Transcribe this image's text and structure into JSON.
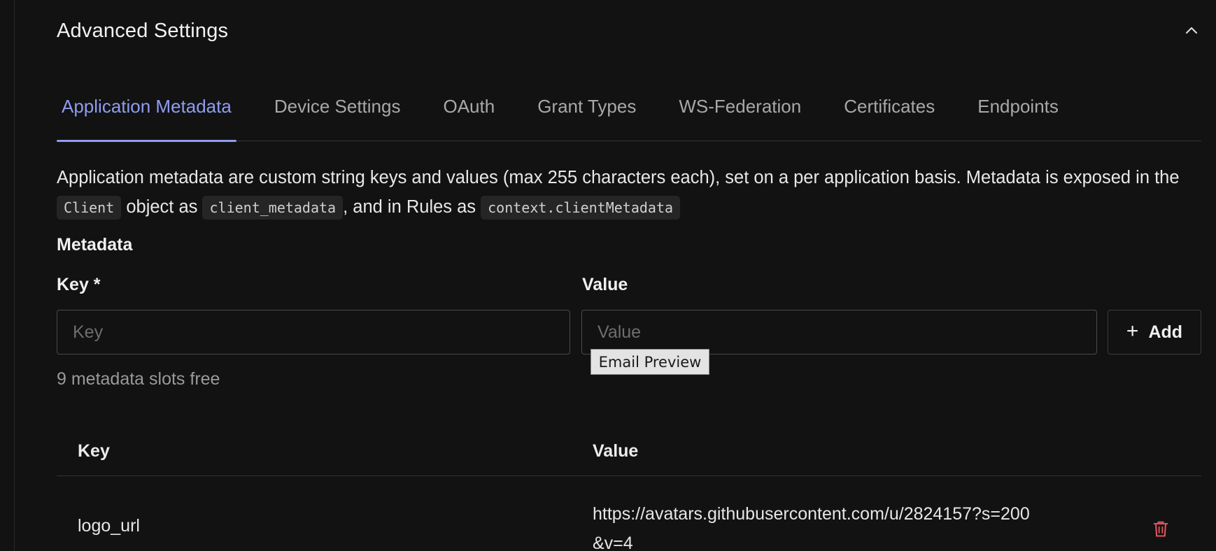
{
  "section": {
    "title": "Advanced Settings"
  },
  "tabs": [
    {
      "label": "Application Metadata",
      "active": true
    },
    {
      "label": "Device Settings",
      "active": false
    },
    {
      "label": "OAuth",
      "active": false
    },
    {
      "label": "Grant Types",
      "active": false
    },
    {
      "label": "WS-Federation",
      "active": false
    },
    {
      "label": "Certificates",
      "active": false
    },
    {
      "label": "Endpoints",
      "active": false
    }
  ],
  "description": {
    "text_1": "Application metadata are custom string keys and values (max 255 characters each), set on a per application basis. Metadata is exposed in the ",
    "code_1": "Client",
    "text_2": " object as ",
    "code_2": "client_metadata",
    "text_3": ", and in Rules as ",
    "code_3": "context.clientMetadata"
  },
  "metadata_form": {
    "heading": "Metadata",
    "key_label": "Key *",
    "value_label": "Value",
    "key_placeholder": "Key",
    "value_placeholder": "Value",
    "key_value": "",
    "value_value": "",
    "add_label": "Add",
    "slots_free": "9 metadata slots free"
  },
  "tooltip": {
    "text": "Email Preview"
  },
  "table": {
    "headers": {
      "key": "Key",
      "value": "Value"
    },
    "rows": [
      {
        "key": "logo_url",
        "value": "https://avatars.githubusercontent.com/u/2824157?s=200&v=4"
      }
    ]
  },
  "icons": {
    "collapse": "chevron-up-icon",
    "add": "plus-icon",
    "delete": "trash-icon"
  },
  "colors": {
    "background": "#121212",
    "accent": "#8f9cf0",
    "danger": "#e0535b",
    "border": "#4a4a4a"
  }
}
